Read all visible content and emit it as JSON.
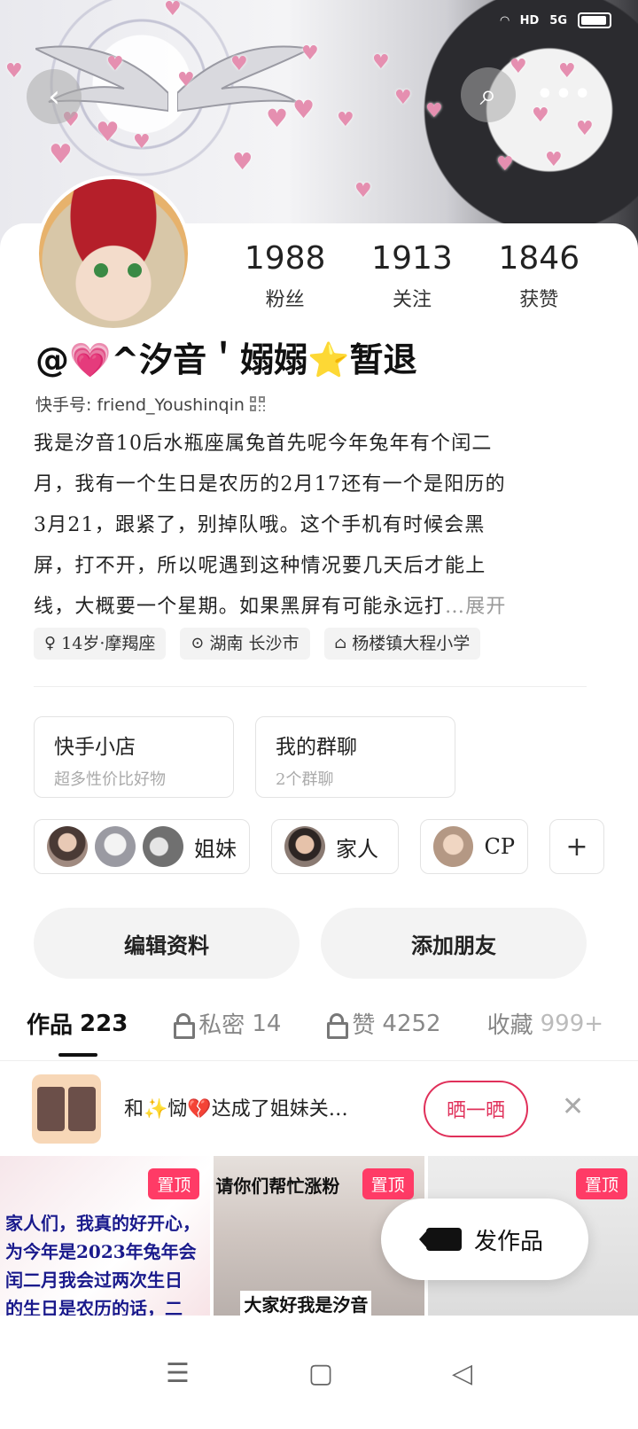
{
  "status": {
    "network": "5G",
    "hd": "HD"
  },
  "header": {
    "back_icon": "‹",
    "search_icon": "⌕",
    "more_icon": "•••"
  },
  "stats": [
    {
      "num": "1988",
      "label": "粉丝"
    },
    {
      "num": "1913",
      "label": "关注"
    },
    {
      "num": "1846",
      "label": "获赞"
    }
  ],
  "profile": {
    "name": "@💗^汐音＇嫋嫋⭐暂退",
    "kuaishou_id": "快手号: friend_Youshinqin",
    "bio_lines": [
      "我是汐音10后水瓶座属兔首先呢今年兔年有个闰二",
      "月，我有一个生日是农历的2月17还有一个是阳历的",
      "3月21，跟紧了，别掉队哦。这个手机有时候会黑",
      "屏，打不开，所以呢遇到这种情况要几天后才能上",
      "线，大概要一个星期。如果黑屏有可能永远打"
    ],
    "bio_ellipsis": "…",
    "bio_more": "展开",
    "tags": [
      {
        "icon": "♀",
        "text": "14岁·摩羯座"
      },
      {
        "icon": "⊙",
        "text": "湖南 长沙市"
      },
      {
        "icon": "⌂",
        "text": "杨楼镇大程小学"
      }
    ]
  },
  "shop": [
    {
      "title": "快手小店",
      "sub": "超多性价比好物"
    },
    {
      "title": "我的群聊",
      "sub": "2个群聊"
    }
  ],
  "groups": [
    {
      "label": "姐妹"
    },
    {
      "label": "家人"
    },
    {
      "label": "CP"
    }
  ],
  "groups_add": "+",
  "actions": {
    "edit": "编辑资料",
    "add_friend": "添加朋友"
  },
  "tabs": [
    {
      "label": "作品",
      "count": "223"
    },
    {
      "label": "私密",
      "count": "14"
    },
    {
      "label": "赞",
      "count": "4252"
    },
    {
      "label": "收藏",
      "count": "999+"
    }
  ],
  "notice": {
    "text": "和✨恸💔达成了姐妹关…",
    "button": "晒一晒",
    "close": "✕"
  },
  "grid": [
    {
      "pin": "置顶",
      "lines": [
        "家人们，我真的好开心，",
        "为今年是2023年兔年会",
        "闰二月我会过两次生日",
        "的生日是农历的话，二"
      ]
    },
    {
      "pin": "置顶",
      "top": "请你们帮忙涨粉",
      "bottom": "大家好我是汐音"
    },
    {
      "pin": "置顶"
    }
  ],
  "fab": {
    "label": "发作品"
  },
  "nav": {
    "menu": "☰",
    "home": "▢",
    "back": "◁"
  }
}
